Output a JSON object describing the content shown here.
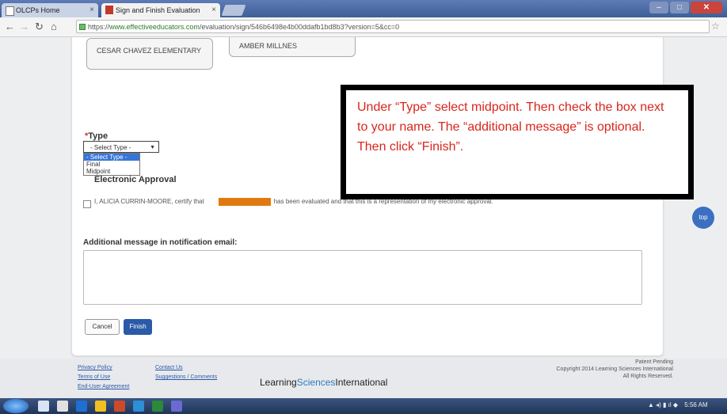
{
  "browser": {
    "tabs": [
      {
        "label": "OLCPs Home"
      },
      {
        "label": "Sign and Finish Evaluation"
      }
    ],
    "url_prefix": "https://",
    "url_host": "www.effectiveeducators.com",
    "url_path": "/evaluation/sign/546b6498e4b00ddafb1bd8b3?version=5&cc=0"
  },
  "form": {
    "school_1": "CESAR CHAVEZ ELEMENTARY",
    "school_2": "AMBER MILLNES",
    "type_required_mark": "*",
    "type_label": "Type",
    "select_value": "- Select Type -",
    "options": [
      "- Select Type -",
      "Final",
      "Midpoint"
    ],
    "approval_label": "Electronic Approval",
    "cert_before": "I, ALICIA CURRIN-MOORE, certify that",
    "cert_after": "has been evaluated and that this is a representation of my electronic approval.",
    "message_label": "Additional message in notification email:",
    "message_value": "",
    "cancel_label": "Cancel",
    "finish_label": "Finish",
    "top_label": "top"
  },
  "callout": {
    "text": "Under “Type” select midpoint. Then check the box next to your name. The “additional message” is optional. Then click “Finish”."
  },
  "footer": {
    "privacy": "Privacy Policy",
    "terms": "Terms of Use",
    "eula": "End-User Agreement",
    "contact": "Contact Us",
    "suggestions": "Suggestions / Comments",
    "logo_a": "Learning",
    "logo_b": "Sciences",
    "logo_c": "International",
    "patent": "Patent Pending",
    "copyright": "Copyright 2014 Learning Sciences International",
    "rights": "All Rights Reserved."
  },
  "taskbar": {
    "time": "5:56 AM"
  }
}
